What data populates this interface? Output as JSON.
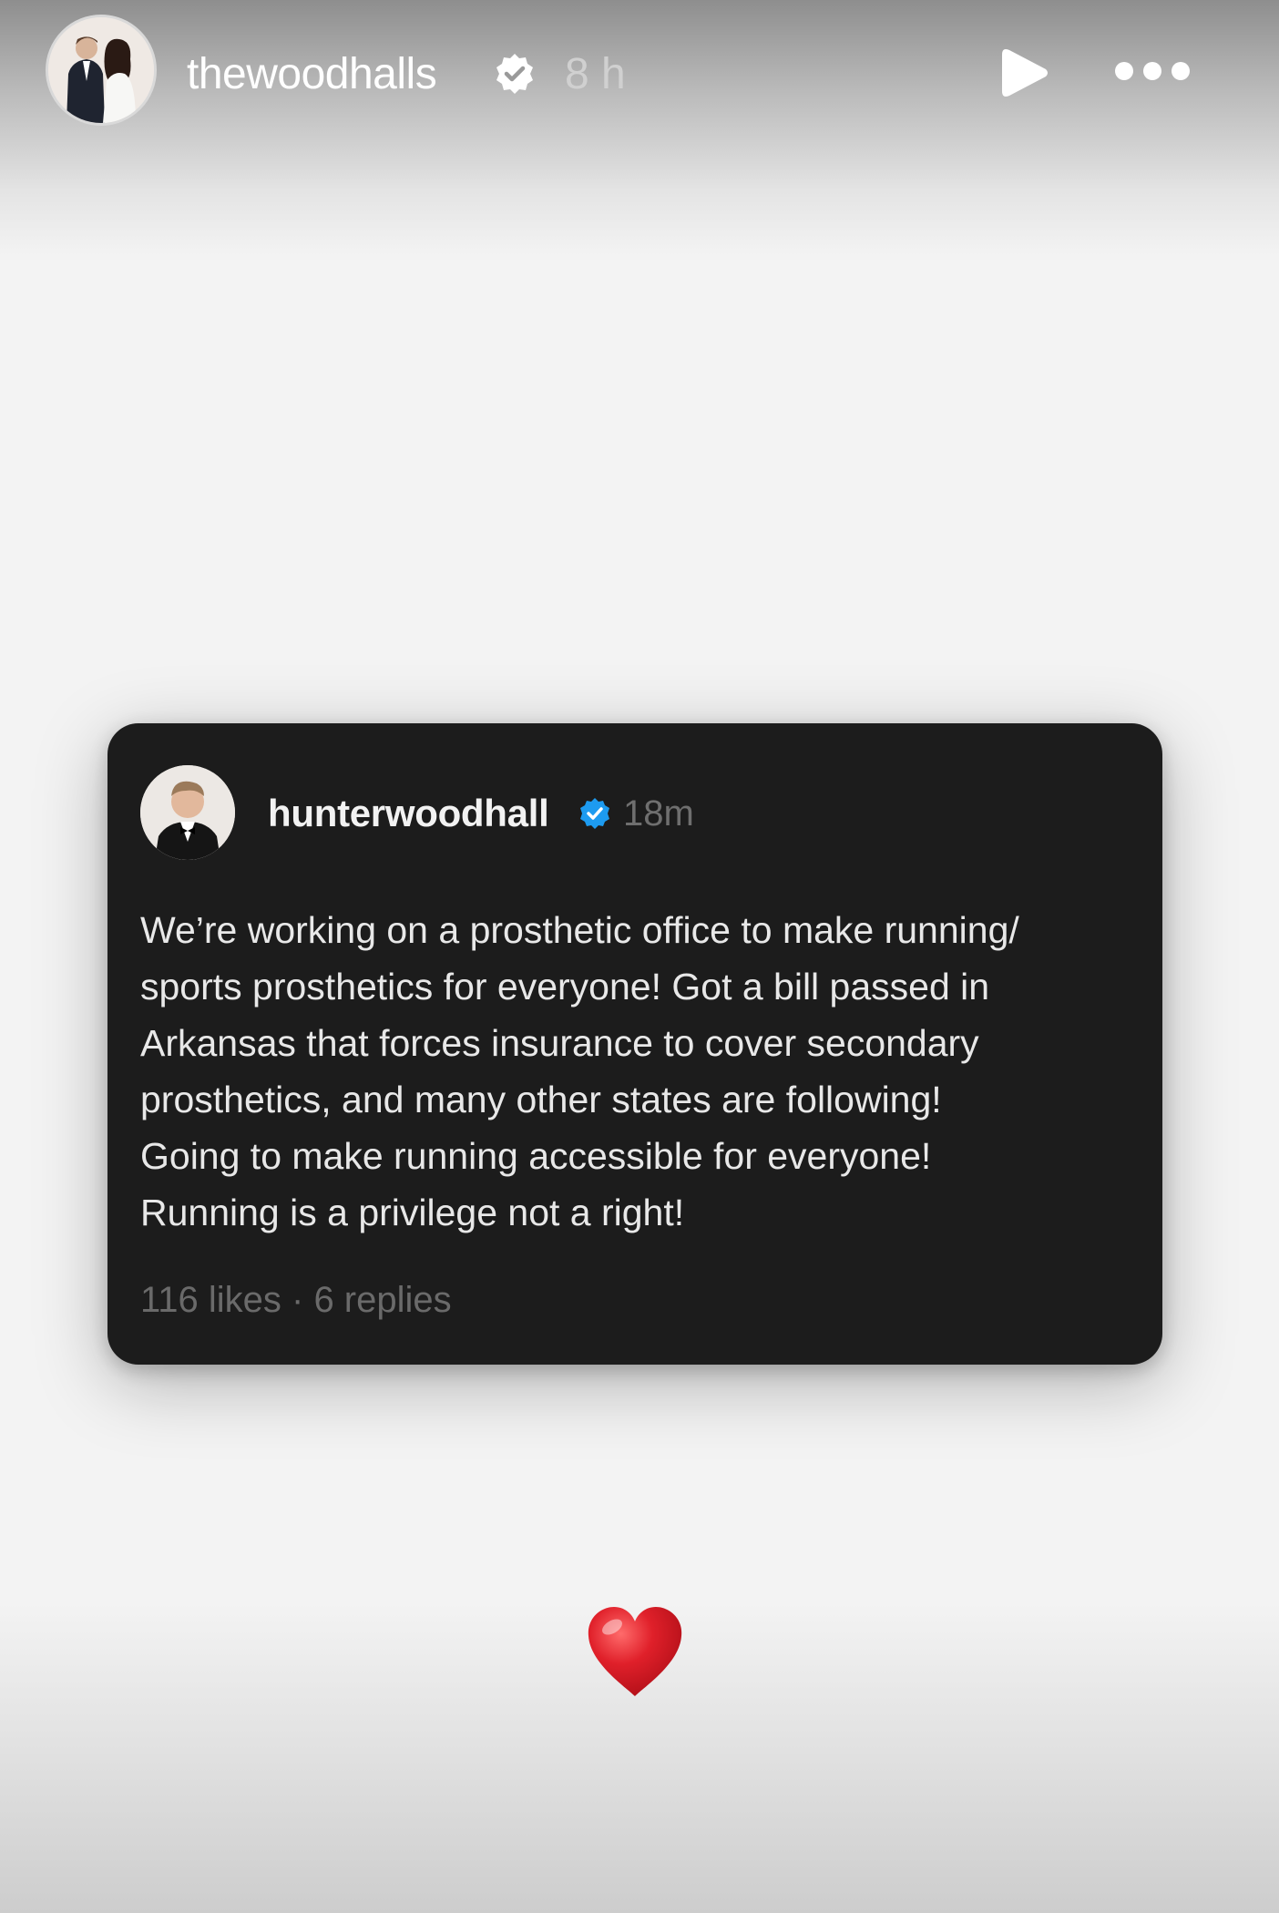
{
  "header": {
    "username": "thewoodhalls",
    "time": "8 h"
  },
  "post": {
    "username": "hunterwoodhall",
    "time": "18m",
    "lines": [
      "We’re working on a prosthetic office to make running/",
      "sports prosthetics for everyone! Got a bill passed in",
      "Arkansas that forces insurance to cover secondary",
      "prosthetics, and many other states are following!",
      "Going to make running accessible for everyone!",
      "Running is a privilege not a right!"
    ],
    "stats": "116 likes · 6 replies"
  },
  "colors": {
    "verified_blue": "#1d9bf0",
    "heart_red": "#e0202a",
    "card_bg": "#1c1c1c"
  },
  "icons": [
    "verified-badge-icon",
    "play-icon",
    "more-icon",
    "heart-icon"
  ]
}
